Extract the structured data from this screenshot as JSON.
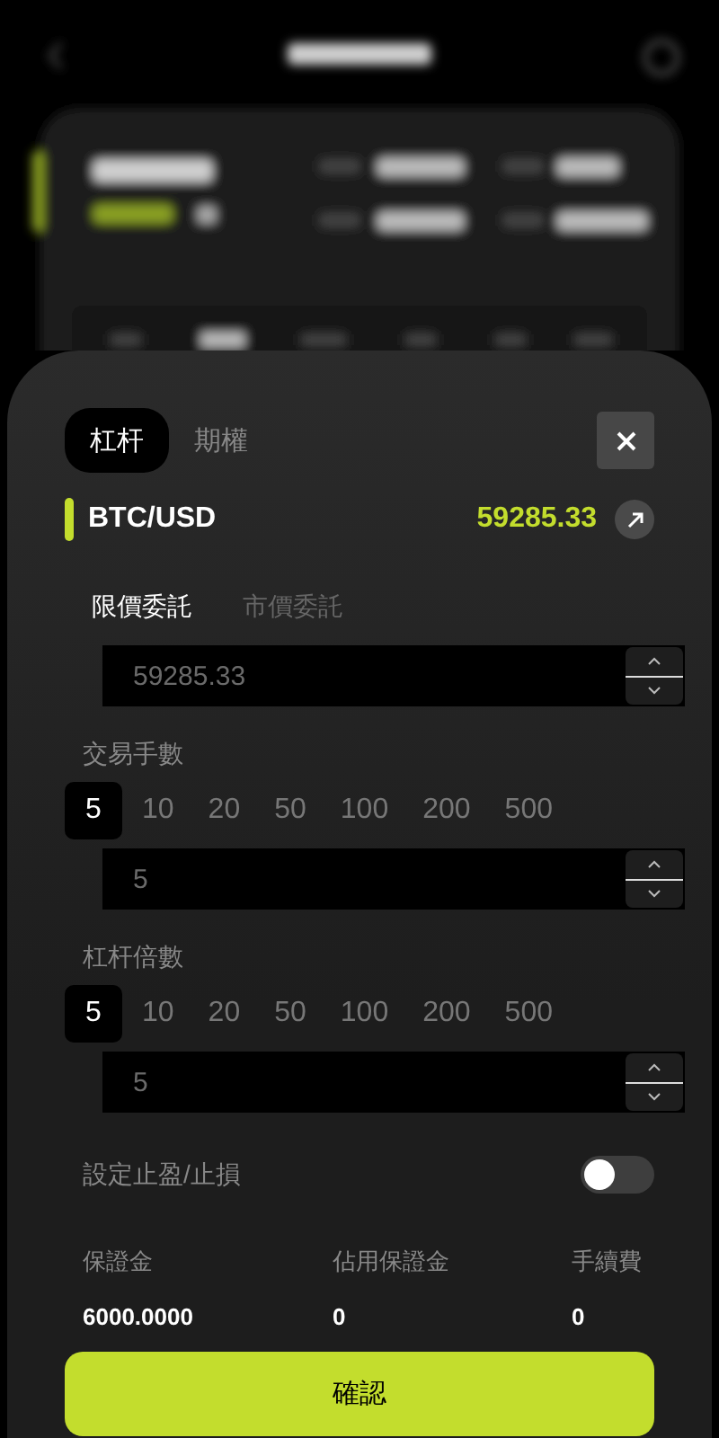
{
  "sheet_tabs": [
    {
      "label": "杠杆",
      "selected": true
    },
    {
      "label": "期權",
      "selected": false
    }
  ],
  "pair": {
    "symbol": "BTC/USD",
    "price": "59285.33"
  },
  "order_types": [
    {
      "label": "限價委託",
      "selected": true
    },
    {
      "label": "市價委託",
      "selected": false
    }
  ],
  "price_field": {
    "value": "59285.33"
  },
  "lots": {
    "label": "交易手數",
    "presets": [
      {
        "label": "5",
        "selected": true
      },
      {
        "label": "10",
        "selected": false
      },
      {
        "label": "20",
        "selected": false
      },
      {
        "label": "50",
        "selected": false
      },
      {
        "label": "100",
        "selected": false
      },
      {
        "label": "200",
        "selected": false
      },
      {
        "label": "500",
        "selected": false
      }
    ],
    "value": "5"
  },
  "leverage": {
    "label": "杠杆倍數",
    "presets": [
      {
        "label": "5",
        "selected": true
      },
      {
        "label": "10",
        "selected": false
      },
      {
        "label": "20",
        "selected": false
      },
      {
        "label": "50",
        "selected": false
      },
      {
        "label": "100",
        "selected": false
      },
      {
        "label": "200",
        "selected": false
      },
      {
        "label": "500",
        "selected": false
      }
    ],
    "value": "5"
  },
  "take_profit": {
    "label": "設定止盈/止損",
    "on": false
  },
  "summary": [
    {
      "label": "保證金",
      "value": "6000.0000"
    },
    {
      "label": "佔用保證金",
      "value": "0"
    },
    {
      "label": "手續費",
      "value": "0"
    }
  ],
  "confirm": "確認"
}
